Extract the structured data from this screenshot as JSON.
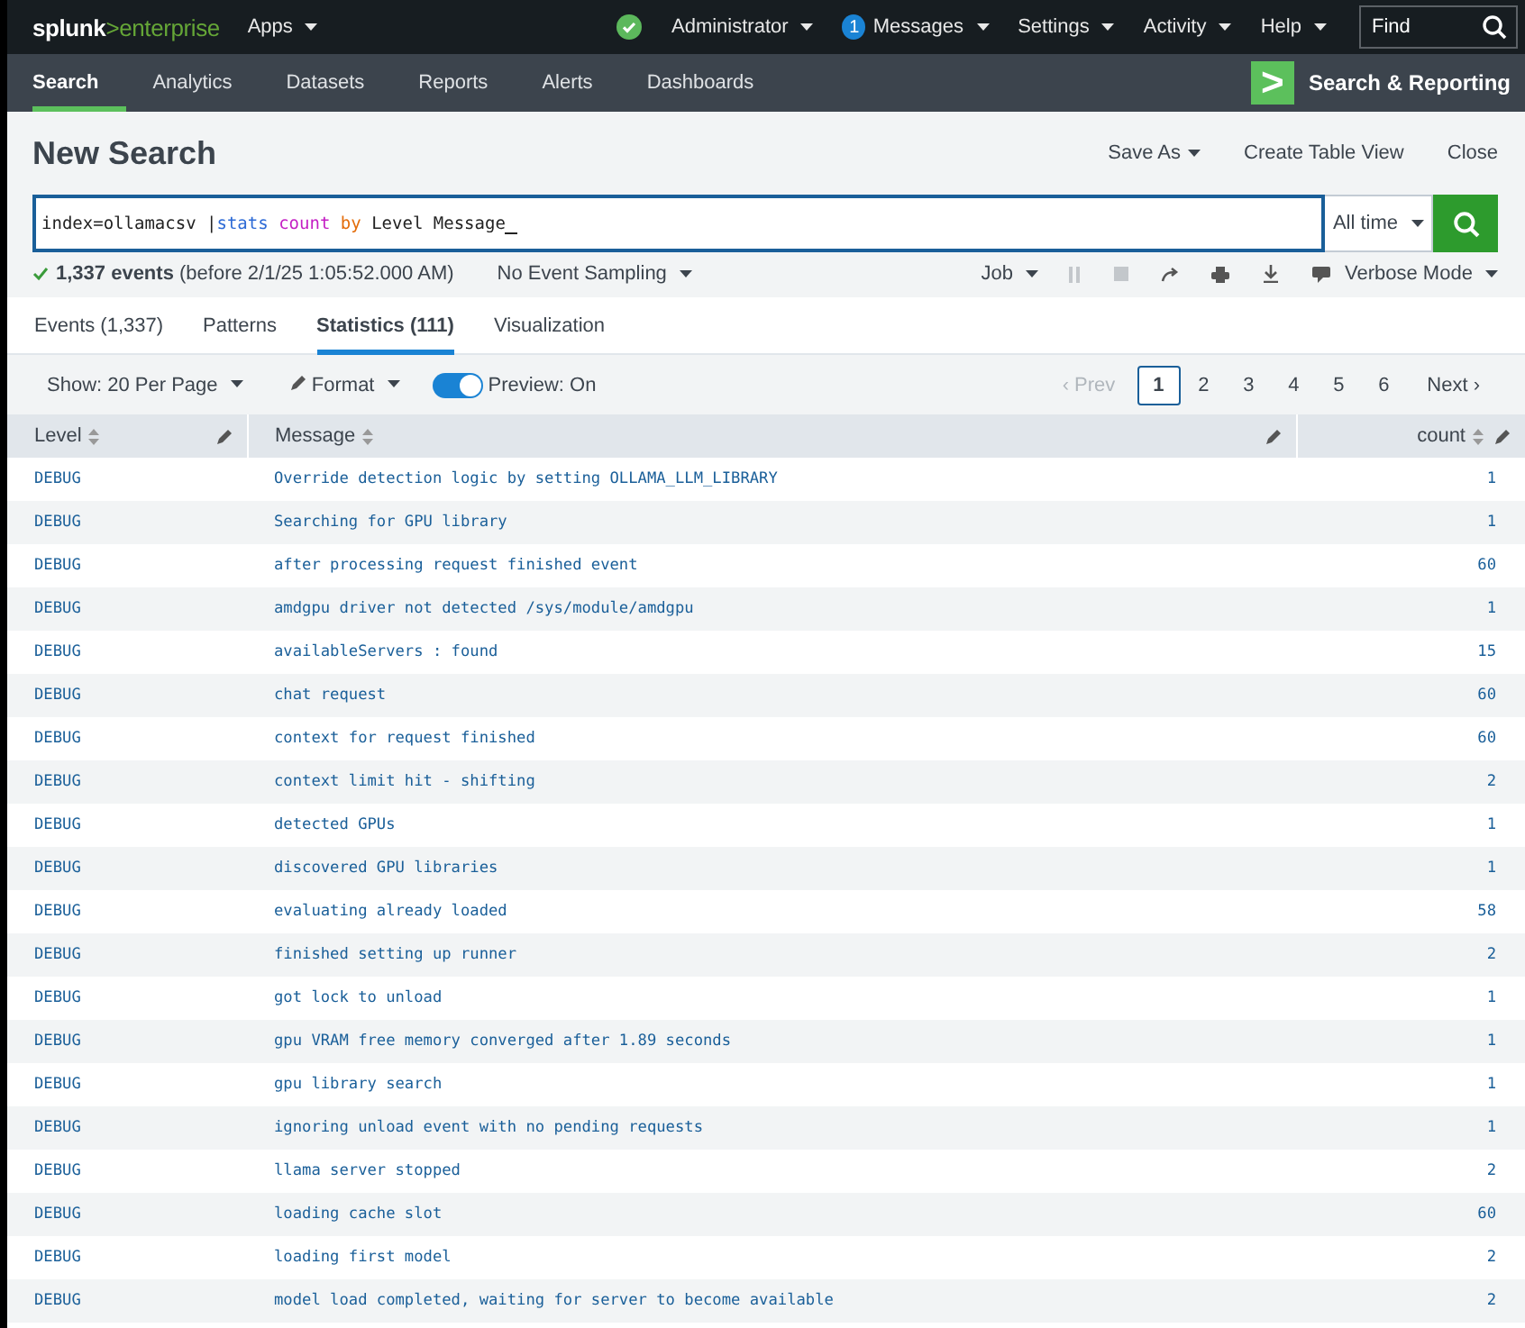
{
  "top_bar": {
    "logo_brand": "splunk",
    "logo_separator": ">",
    "logo_product": "enterprise",
    "menus": [
      {
        "label": "Apps",
        "kind": "menu"
      },
      {
        "label": "Administrator",
        "kind": "status"
      },
      {
        "label": "Messages",
        "kind": "badge",
        "badge": "1"
      },
      {
        "label": "Settings",
        "kind": "menu"
      },
      {
        "label": "Activity",
        "kind": "menu"
      },
      {
        "label": "Help",
        "kind": "menu"
      }
    ],
    "find": {
      "placeholder": "Find"
    }
  },
  "app_bar": {
    "tabs": [
      {
        "label": "Search",
        "selected": true
      },
      {
        "label": "Analytics",
        "selected": false
      },
      {
        "label": "Datasets",
        "selected": false
      },
      {
        "label": "Reports",
        "selected": false
      },
      {
        "label": "Alerts",
        "selected": false
      },
      {
        "label": "Dashboards",
        "selected": false
      }
    ],
    "app_icon": ">",
    "app_name": "Search & Reporting"
  },
  "header": {
    "title": "New Search",
    "actions": [
      {
        "label": "Save As",
        "dropdown": true
      },
      {
        "label": "Create Table View",
        "dropdown": false
      },
      {
        "label": "Close",
        "dropdown": false
      }
    ]
  },
  "search": {
    "query": [
      {
        "kind": "text",
        "text": "index=ollamacsv |"
      },
      {
        "kind": "command",
        "text": "stats"
      },
      {
        "kind": "function",
        "text": " count"
      },
      {
        "kind": "keyword",
        "text": " by"
      },
      {
        "kind": "text",
        "text": " Level Message"
      }
    ],
    "time_range": "All time"
  },
  "status": {
    "events": "1,337 events",
    "detail": "(before 2/1/25 1:05:52.000 AM)",
    "sampling": "No Event Sampling",
    "job": "Job",
    "mode": "Verbose Mode"
  },
  "result_tabs": [
    {
      "label": "Events (1,337)",
      "selected": false
    },
    {
      "label": "Patterns",
      "selected": false
    },
    {
      "label": "Statistics (111)",
      "selected": true
    },
    {
      "label": "Visualization",
      "selected": false
    }
  ],
  "table_toolbar": {
    "per_page": "Show: 20 Per Page",
    "format": "Format",
    "preview": {
      "label": "Preview: On",
      "on": true
    },
    "pager": [
      {
        "label": "‹ Prev",
        "kind": "prev",
        "disabled": true
      },
      {
        "label": "1",
        "kind": "page",
        "selected": true
      },
      {
        "label": "2",
        "kind": "page",
        "selected": false
      },
      {
        "label": "3",
        "kind": "page",
        "selected": false
      },
      {
        "label": "4",
        "kind": "page",
        "selected": false
      },
      {
        "label": "5",
        "kind": "page",
        "selected": false
      },
      {
        "label": "6",
        "kind": "page",
        "selected": false
      },
      {
        "label": "Next ›",
        "kind": "next",
        "disabled": false
      }
    ]
  },
  "table": {
    "columns": [
      "Level",
      "Message",
      "count"
    ],
    "rows": [
      [
        "DEBUG",
        "Override detection logic by setting OLLAMA_LLM_LIBRARY",
        "1"
      ],
      [
        "DEBUG",
        "Searching for GPU library",
        "1"
      ],
      [
        "DEBUG",
        "after processing request finished event",
        "60"
      ],
      [
        "DEBUG",
        "amdgpu driver not detected /sys/module/amdgpu",
        "1"
      ],
      [
        "DEBUG",
        "availableServers : found",
        "15"
      ],
      [
        "DEBUG",
        "chat request",
        "60"
      ],
      [
        "DEBUG",
        "context for request finished",
        "60"
      ],
      [
        "DEBUG",
        "context limit hit - shifting",
        "2"
      ],
      [
        "DEBUG",
        "detected GPUs",
        "1"
      ],
      [
        "DEBUG",
        "discovered GPU libraries",
        "1"
      ],
      [
        "DEBUG",
        "evaluating already loaded",
        "58"
      ],
      [
        "DEBUG",
        "finished setting up runner",
        "2"
      ],
      [
        "DEBUG",
        "got lock to unload",
        "1"
      ],
      [
        "DEBUG",
        "gpu VRAM free memory converged after 1.89 seconds",
        "1"
      ],
      [
        "DEBUG",
        "gpu library search",
        "1"
      ],
      [
        "DEBUG",
        "ignoring unload event with no pending requests",
        "1"
      ],
      [
        "DEBUG",
        "llama server stopped",
        "2"
      ],
      [
        "DEBUG",
        "loading cache slot",
        "60"
      ],
      [
        "DEBUG",
        "loading first model",
        "2"
      ],
      [
        "DEBUG",
        "model load completed, waiting for server to become available",
        "2"
      ]
    ]
  }
}
